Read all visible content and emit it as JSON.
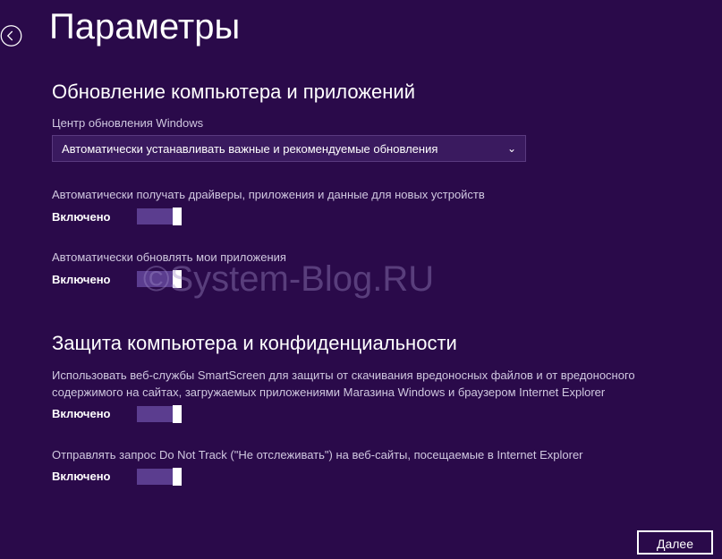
{
  "header": {
    "title": "Параметры"
  },
  "section1": {
    "title": "Обновление компьютера и приложений",
    "windows_update_label": "Центр обновления Windows",
    "dropdown_value": "Автоматически устанавливать важные и рекомендуемые обновления",
    "setting1": {
      "description": "Автоматически получать драйверы, приложения и данные для новых устройств",
      "status": "Включено"
    },
    "setting2": {
      "description": "Автоматически обновлять мои приложения",
      "status": "Включено"
    }
  },
  "section2": {
    "title": "Защита компьютера и конфиденциальности",
    "setting1": {
      "description": "Использовать веб-службы SmartScreen для защиты от скачивания вредоносных файлов и от вредоносного содержимого на сайтах, загружаемых приложениями Магазина Windows и браузером Internet Explorer",
      "status": "Включено"
    },
    "setting2": {
      "description": "Отправлять запрос Do Not Track (\"Не отслеживать\") на веб-сайты, посещаемые в Internet Explorer",
      "status": "Включено"
    }
  },
  "footer": {
    "next_button": "Далее"
  },
  "watermark": "©System-Blog.RU"
}
